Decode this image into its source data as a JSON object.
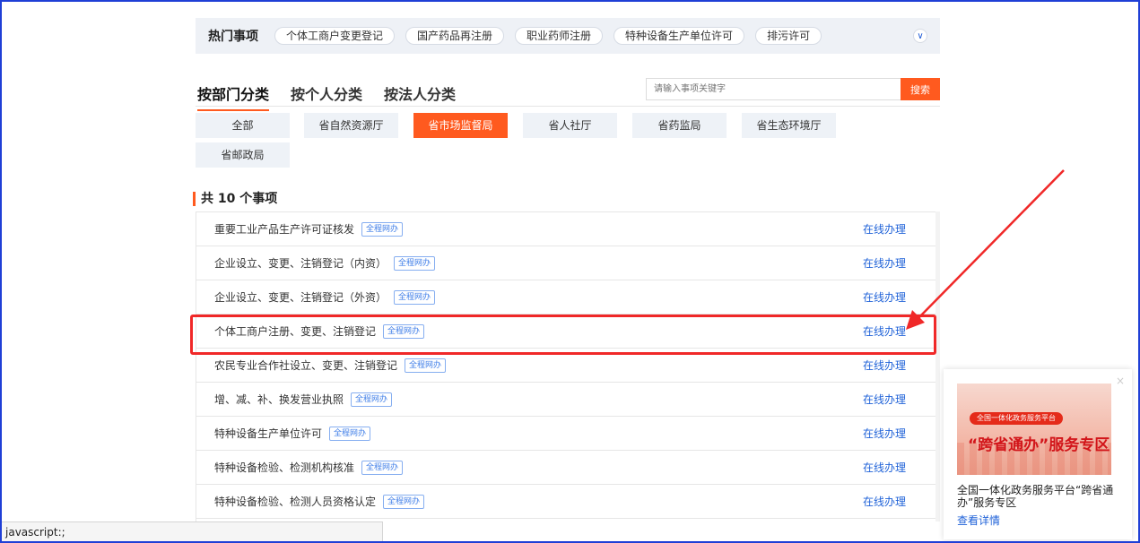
{
  "hot": {
    "title": "热门事项",
    "tags": [
      "个体工商户变更登记",
      "国产药品再注册",
      "职业药师注册",
      "特种设备生产单位许可",
      "排污许可"
    ],
    "toggle_icon": "chevron-down-icon"
  },
  "tabs": [
    "按部门分类",
    "按个人分类",
    "按法人分类"
  ],
  "search": {
    "placeholder": "请输入事项关键字",
    "button": "搜索"
  },
  "departments": [
    "全部",
    "省自然资源厅",
    "省市场监督局",
    "省人社厅",
    "省药监局",
    "省生态环境厅",
    "省邮政局"
  ],
  "active_department": "省市场监督局",
  "count_label": "共 10 个事项",
  "items": [
    {
      "name": "重要工业产品生产许可证核发",
      "badge": "全程网办",
      "action": "在线办理"
    },
    {
      "name": "企业设立、变更、注销登记（内资）",
      "badge": "全程网办",
      "action": "在线办理"
    },
    {
      "name": "企业设立、变更、注销登记（外资）",
      "badge": "全程网办",
      "action": "在线办理"
    },
    {
      "name": "个体工商户注册、变更、注销登记",
      "badge": "全程网办",
      "action": "在线办理"
    },
    {
      "name": "农民专业合作社设立、变更、注销登记",
      "badge": "全程网办",
      "action": "在线办理"
    },
    {
      "name": "增、减、补、换发营业执照",
      "badge": "全程网办",
      "action": "在线办理"
    },
    {
      "name": "特种设备生产单位许可",
      "badge": "全程网办",
      "action": "在线办理"
    },
    {
      "name": "特种设备检验、检测机构核准",
      "badge": "全程网办",
      "action": "在线办理"
    },
    {
      "name": "特种设备检验、检测人员资格认定",
      "badge": "全程网办",
      "action": "在线办理"
    }
  ],
  "promo": {
    "pill": "全国一体化政务服务平台",
    "headline": "“跨省通办”服务专区",
    "text": "全国一体化政务服务平台“跨省通办”服务专区",
    "link": "查看详情",
    "close": "×"
  },
  "status_text": "javascript:;",
  "colors": {
    "accent": "#ff5a1f",
    "link": "#1f62d8",
    "highlight": "#f02828"
  }
}
